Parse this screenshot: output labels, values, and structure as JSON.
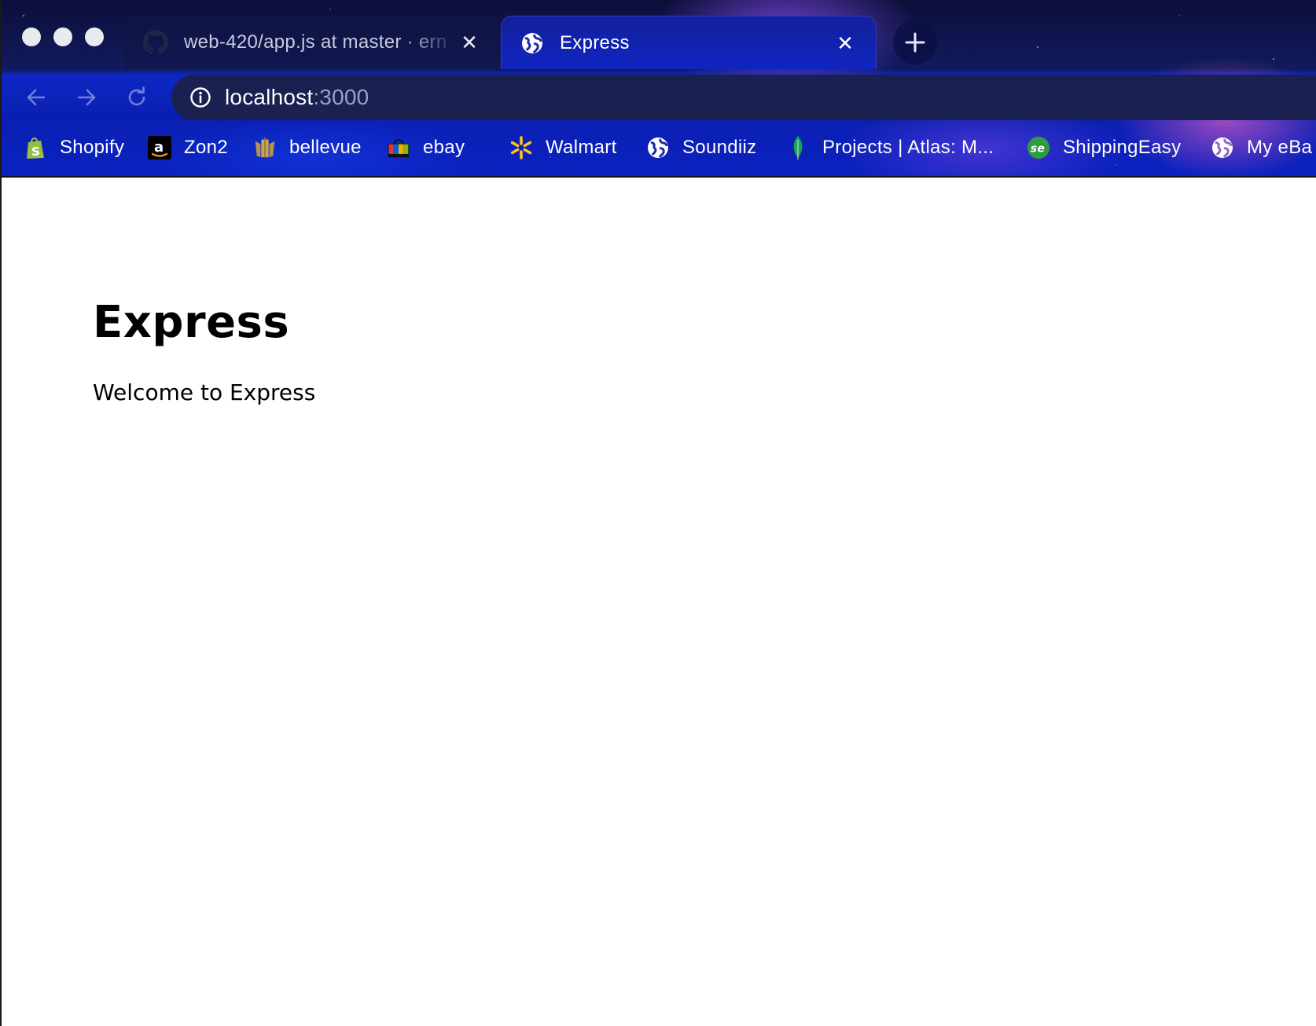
{
  "tabs": [
    {
      "title": "web-420/app.js at master · ern",
      "favicon": "github-icon",
      "active": false
    },
    {
      "title": "Express",
      "favicon": "globe-icon",
      "active": true
    }
  ],
  "address_bar": {
    "host": "localhost",
    "port": ":3000"
  },
  "bookmarks": [
    {
      "label": "Shopify",
      "icon": "shopify-icon"
    },
    {
      "label": "Zon2",
      "icon": "amazon-icon"
    },
    {
      "label": "bellevue",
      "icon": "bellevue-icon"
    },
    {
      "label": "ebay",
      "icon": "shopping-bag-icon"
    },
    {
      "label": "Walmart",
      "icon": "walmart-spark-icon"
    },
    {
      "label": "Soundiiz",
      "icon": "globe-icon"
    },
    {
      "label": "Projects | Atlas: M...",
      "icon": "mongodb-leaf-icon"
    },
    {
      "label": "ShippingEasy",
      "icon": "shippingeasy-icon"
    },
    {
      "label": "My eBa",
      "icon": "globe-icon"
    }
  ],
  "page": {
    "heading": "Express",
    "body": "Welcome to Express"
  },
  "colors": {
    "theme_dark": "#0d0f3a",
    "theme_blue": "#0b22c0",
    "omnibox": "#1a2150",
    "amazon_orange": "#ff9900",
    "walmart_yellow": "#ffc220",
    "shopify_green": "#95bf47",
    "mongodb_green": "#13aa52",
    "shippingeasy_green": "#2e9c3f"
  }
}
